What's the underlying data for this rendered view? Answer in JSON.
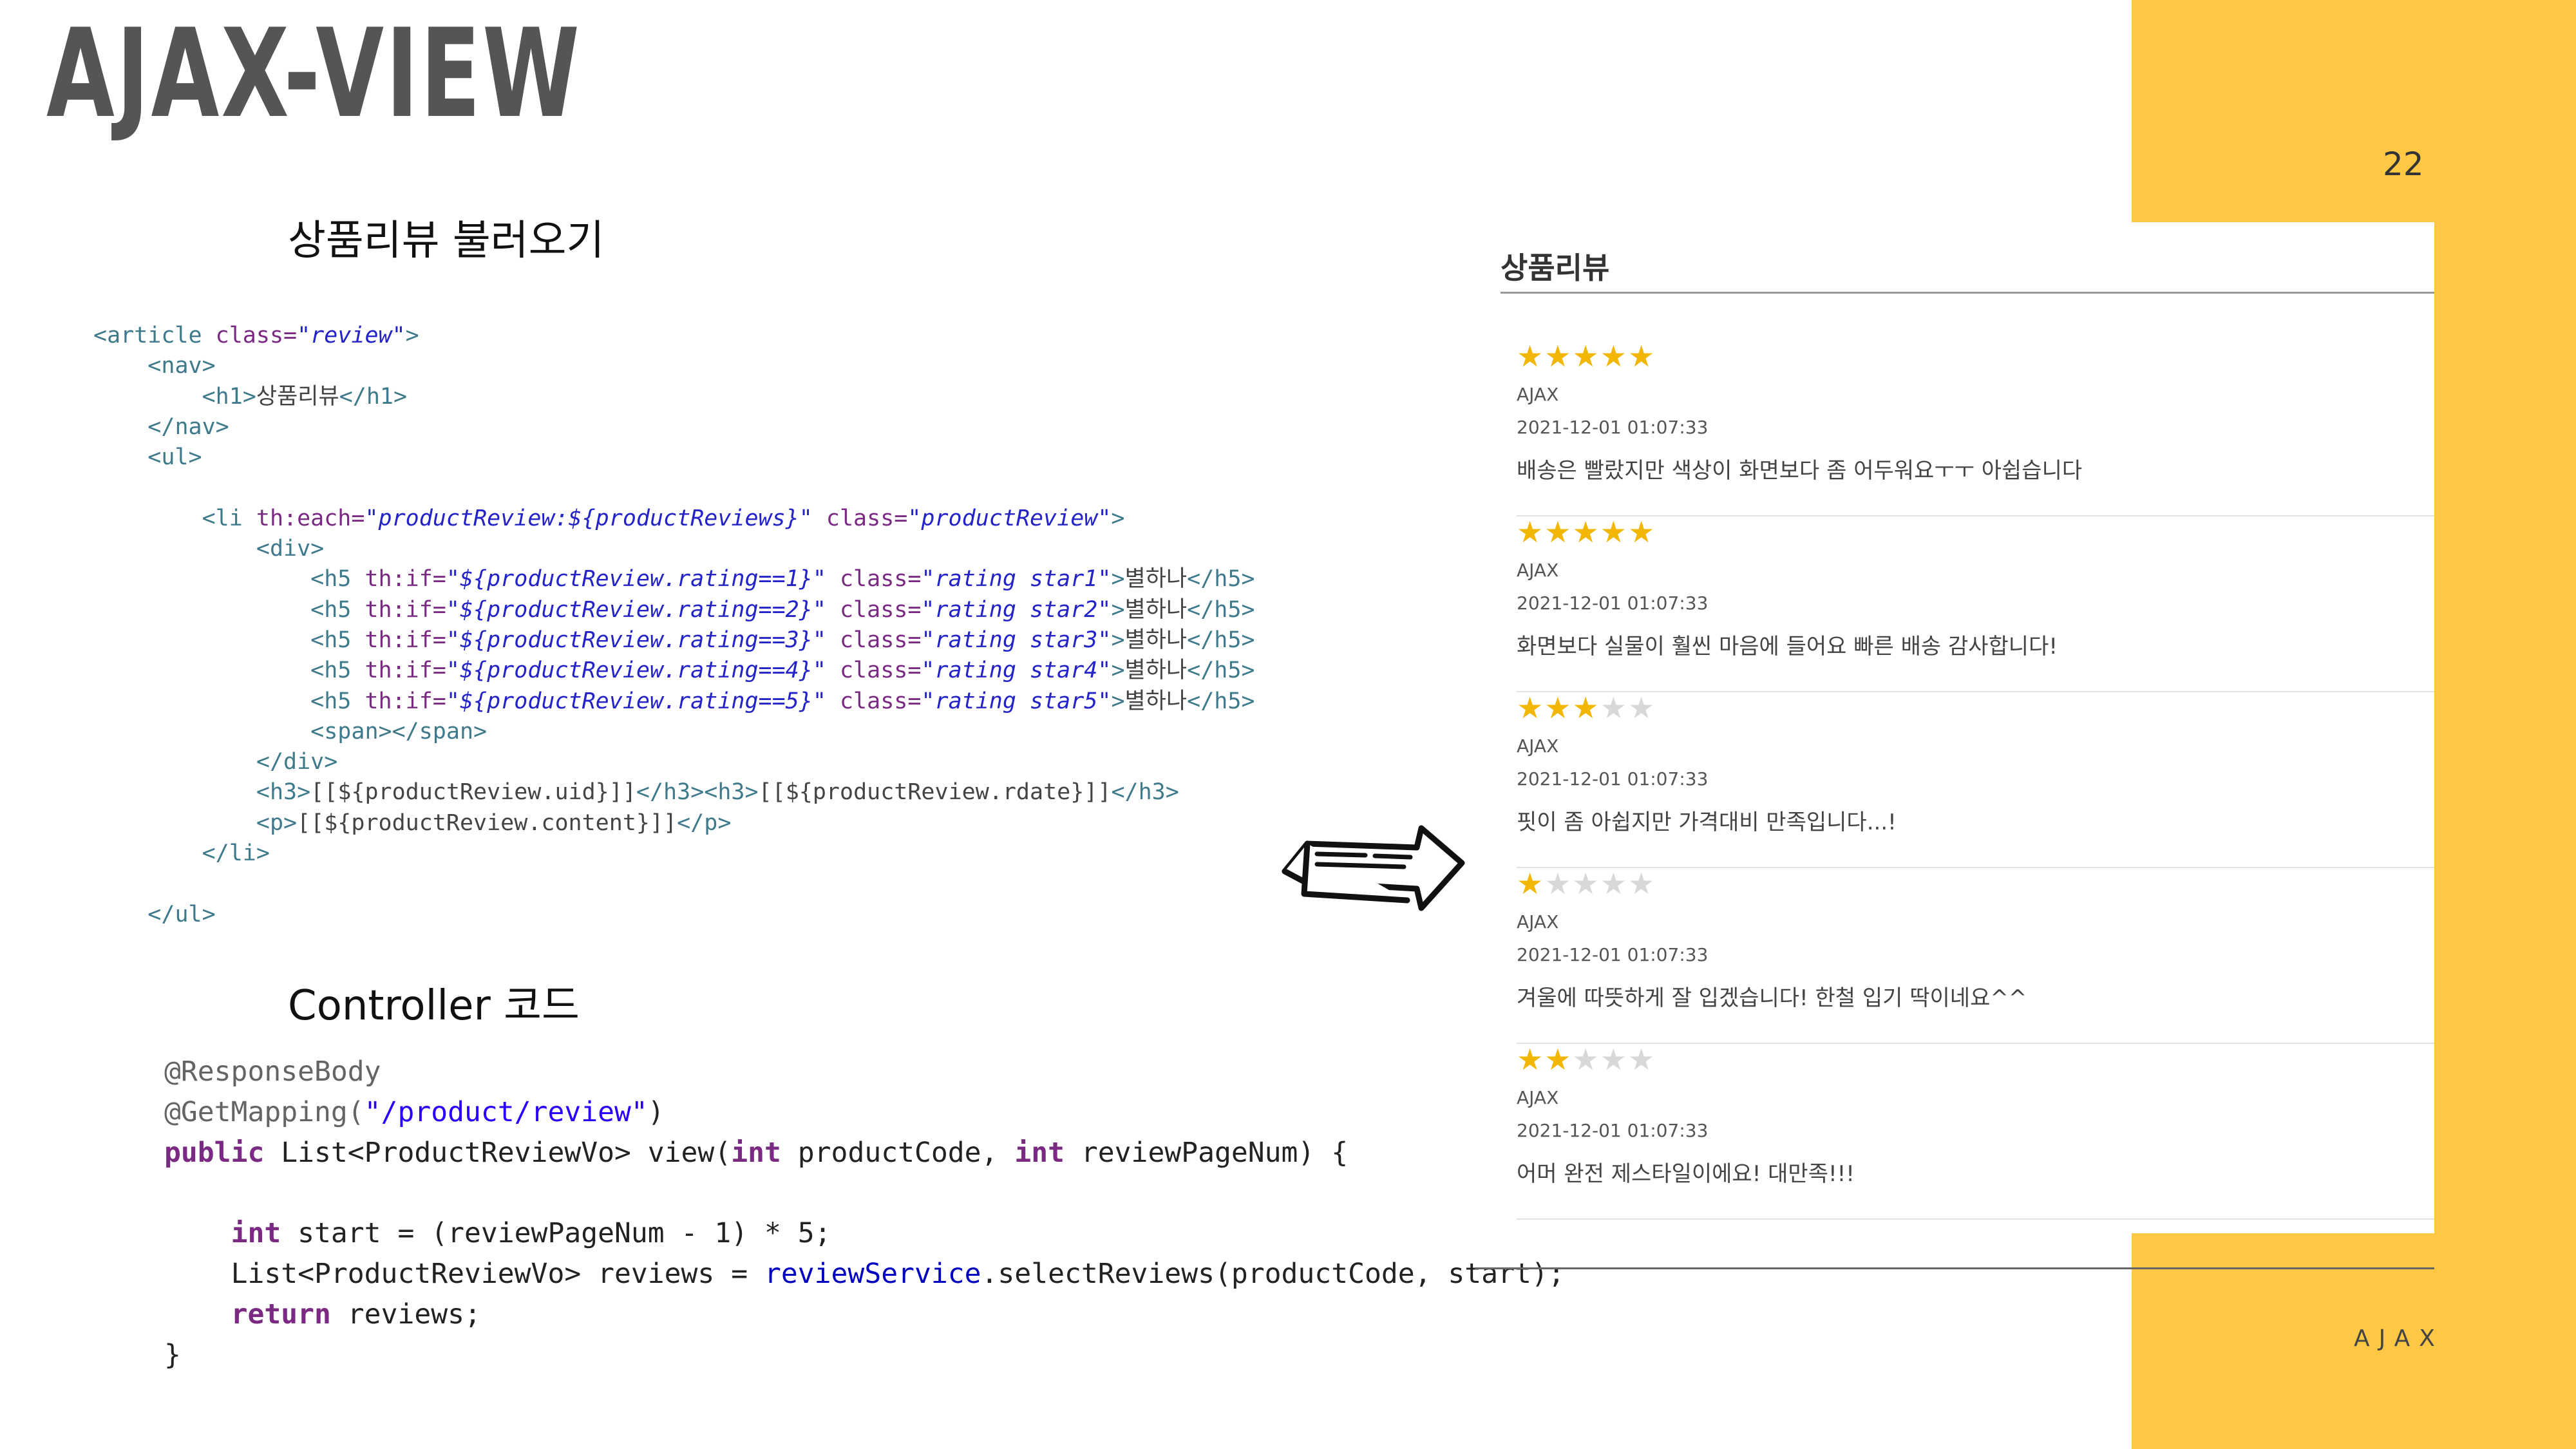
{
  "slide": {
    "title": "AJAX-VIEW",
    "page_number": "22",
    "footer": "AJAX"
  },
  "sections": {
    "review_heading": "상품리뷰 불러오기",
    "controller_heading": "Controller 코드"
  },
  "review_panel": {
    "title": "상품리뷰",
    "reviews": [
      {
        "rating": 5,
        "author": "AJAX",
        "date": "2021-12-01 01:07:33",
        "content": "배송은 빨랐지만 색상이 화면보다 좀 어두워요ㅜㅜ 아쉽습니다"
      },
      {
        "rating": 5,
        "author": "AJAX",
        "date": "2021-12-01 01:07:33",
        "content": "화면보다 실물이 훨씬 마음에 들어요 빠른 배송 감사합니다!"
      },
      {
        "rating": 3,
        "author": "AJAX",
        "date": "2021-12-01 01:07:33",
        "content": "핏이 좀 아쉽지만 가격대비 만족입니다...!"
      },
      {
        "rating": 1,
        "author": "AJAX",
        "date": "2021-12-01 01:07:33",
        "content": "겨울에 따뜻하게 잘 입겠습니다! 한철 입기 딱이네요^^"
      },
      {
        "rating": 2,
        "author": "AJAX",
        "date": "2021-12-01 01:07:33",
        "content": "어머 완전 제스타일이에요! 대만족!!!"
      }
    ]
  },
  "html_code": {
    "l1": {
      "t1": "<article ",
      "a1": "class=",
      "s1": "\"review\"",
      "t2": ">"
    },
    "l2": "<nav>",
    "l3": {
      "t1": "<h1>",
      "txt": "상품리뷰",
      "t2": "</h1>"
    },
    "l4": "</nav>",
    "l5": "<ul>",
    "l6": {
      "t1": "<li ",
      "a1": "th:each=",
      "s1": "\"productReview:${productReviews}\"",
      "a2": " class=",
      "s2": "\"productReview\"",
      "t2": ">"
    },
    "l7": "<div>",
    "h5_lines": [
      {
        "t1": "<h5 ",
        "a1": "th:if=",
        "s1": "\"${productReview.rating==1}\"",
        "a2": " class=",
        "s2": "\"rating star1\"",
        "t2": ">",
        "txt": "별하나",
        "t3": "</h5>"
      },
      {
        "t1": "<h5 ",
        "a1": "th:if=",
        "s1": "\"${productReview.rating==2}\"",
        "a2": " class=",
        "s2": "\"rating star2\"",
        "t2": ">",
        "txt": "별하나",
        "t3": "</h5>"
      },
      {
        "t1": "<h5 ",
        "a1": "th:if=",
        "s1": "\"${productReview.rating==3}\"",
        "a2": " class=",
        "s2": "\"rating star3\"",
        "t2": ">",
        "txt": "별하나",
        "t3": "</h5>"
      },
      {
        "t1": "<h5 ",
        "a1": "th:if=",
        "s1": "\"${productReview.rating==4}\"",
        "a2": " class=",
        "s2": "\"rating star4\"",
        "t2": ">",
        "txt": "별하나",
        "t3": "</h5>"
      },
      {
        "t1": "<h5 ",
        "a1": "th:if=",
        "s1": "\"${productReview.rating==5}\"",
        "a2": " class=",
        "s2": "\"rating star5\"",
        "t2": ">",
        "txt": "별하나",
        "t3": "</h5>"
      }
    ],
    "l13": "<span></span>",
    "l14": "</div>",
    "l15": {
      "t1": "<h3>",
      "txt1": "[[${productReview.uid}]]",
      "t2": "</h3><h3>",
      "txt2": "[[${productReview.rdate}]]",
      "t3": "</h3>"
    },
    "l16": {
      "t1": "<p>",
      "txt": "[[${productReview.content}]]",
      "t2": "</p>"
    },
    "l17": "</li>",
    "l18": "</ul>"
  },
  "java_code": {
    "ann1": "@ResponseBody",
    "ann2": "@GetMapping(",
    "ann2_str": "\"/product/review\"",
    "ann2_end": ")",
    "sig_kw": "public",
    "sig_1": " List<ProductReviewVo> view(",
    "sig_kw2": "int",
    "sig_2": " productCode, ",
    "sig_kw3": "int",
    "sig_3": " reviewPageNum) {",
    "b1_kw": "int",
    "b1_rest": " start = (reviewPageNum - 1) * 5;",
    "b2_a": "List<ProductReviewVo> reviews = ",
    "b2_fld": "reviewService",
    "b2_b": ".selectReviews(productCode, start);",
    "b3_kw": "return",
    "b3_rest": " reviews;",
    "close": "}"
  },
  "colors": {
    "accent_yellow": "#FFC844",
    "star_on": "#F2B705",
    "star_off": "#D8D8D8"
  }
}
